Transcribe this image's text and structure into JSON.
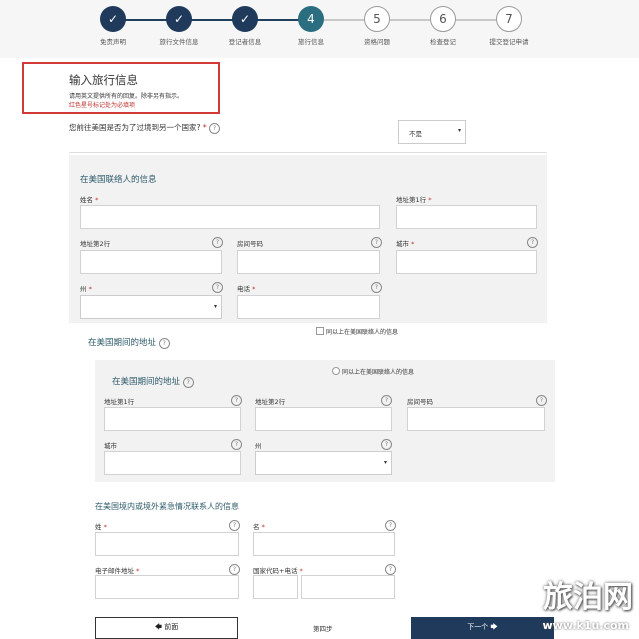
{
  "stepper": {
    "steps": [
      {
        "label": "免责声明",
        "state": "done",
        "mark": "✓"
      },
      {
        "label": "旅行文件信息",
        "state": "done",
        "mark": "✓"
      },
      {
        "label": "登记者信息",
        "state": "done",
        "mark": "✓"
      },
      {
        "label": "旅行信息",
        "state": "current",
        "mark": "4"
      },
      {
        "label": "资格问题",
        "state": "todo",
        "mark": "5"
      },
      {
        "label": "检查登记",
        "state": "todo",
        "mark": "6"
      },
      {
        "label": "提交登记申请",
        "state": "todo",
        "mark": "7"
      }
    ]
  },
  "header": {
    "title": "输入旅行信息",
    "note1": "请用英文提供所有的回复。除非另有指示。",
    "note2": "红色星号标记处为必填项"
  },
  "transit": {
    "question": "您前往美国是否为了过境到另一个国家?",
    "asterisk": "*",
    "value": "不是"
  },
  "contact": {
    "section": "在美国联络人的信息",
    "name_label": "姓名",
    "addr1_label": "地址第1行",
    "addr2_label": "地址第2行",
    "room_label": "房间号码",
    "city_label": "城市",
    "state_label": "州",
    "phone_label": "电话",
    "same_check": "同以上在美国联络人的信息"
  },
  "stay": {
    "section_outer": "在美国期间的地址",
    "section_inner": "在美国期间的地址",
    "same_radio": "同以上在美国联络人的信息",
    "addr1_label": "地址第1行",
    "addr2_label": "地址第2行",
    "room_label": "房间号码",
    "city_label": "城市",
    "state_label": "州"
  },
  "emergency": {
    "section": "在美国境内或境外紧急情况联系人的信息",
    "last_label": "姓",
    "first_label": "名",
    "email_label": "电子邮件地址",
    "phone_label": "国家代码+电话"
  },
  "footer": {
    "prev": "🡄 前面",
    "step": "第四步",
    "next": "下一个 🡆"
  },
  "watermark": {
    "big": "旅泊网",
    "small": "www.k1u.com"
  },
  "colors": {
    "done": "#1f3a5a",
    "current": "#2a6e80",
    "highlight": "#d23a3a",
    "next_button": "#1f3a5a"
  }
}
